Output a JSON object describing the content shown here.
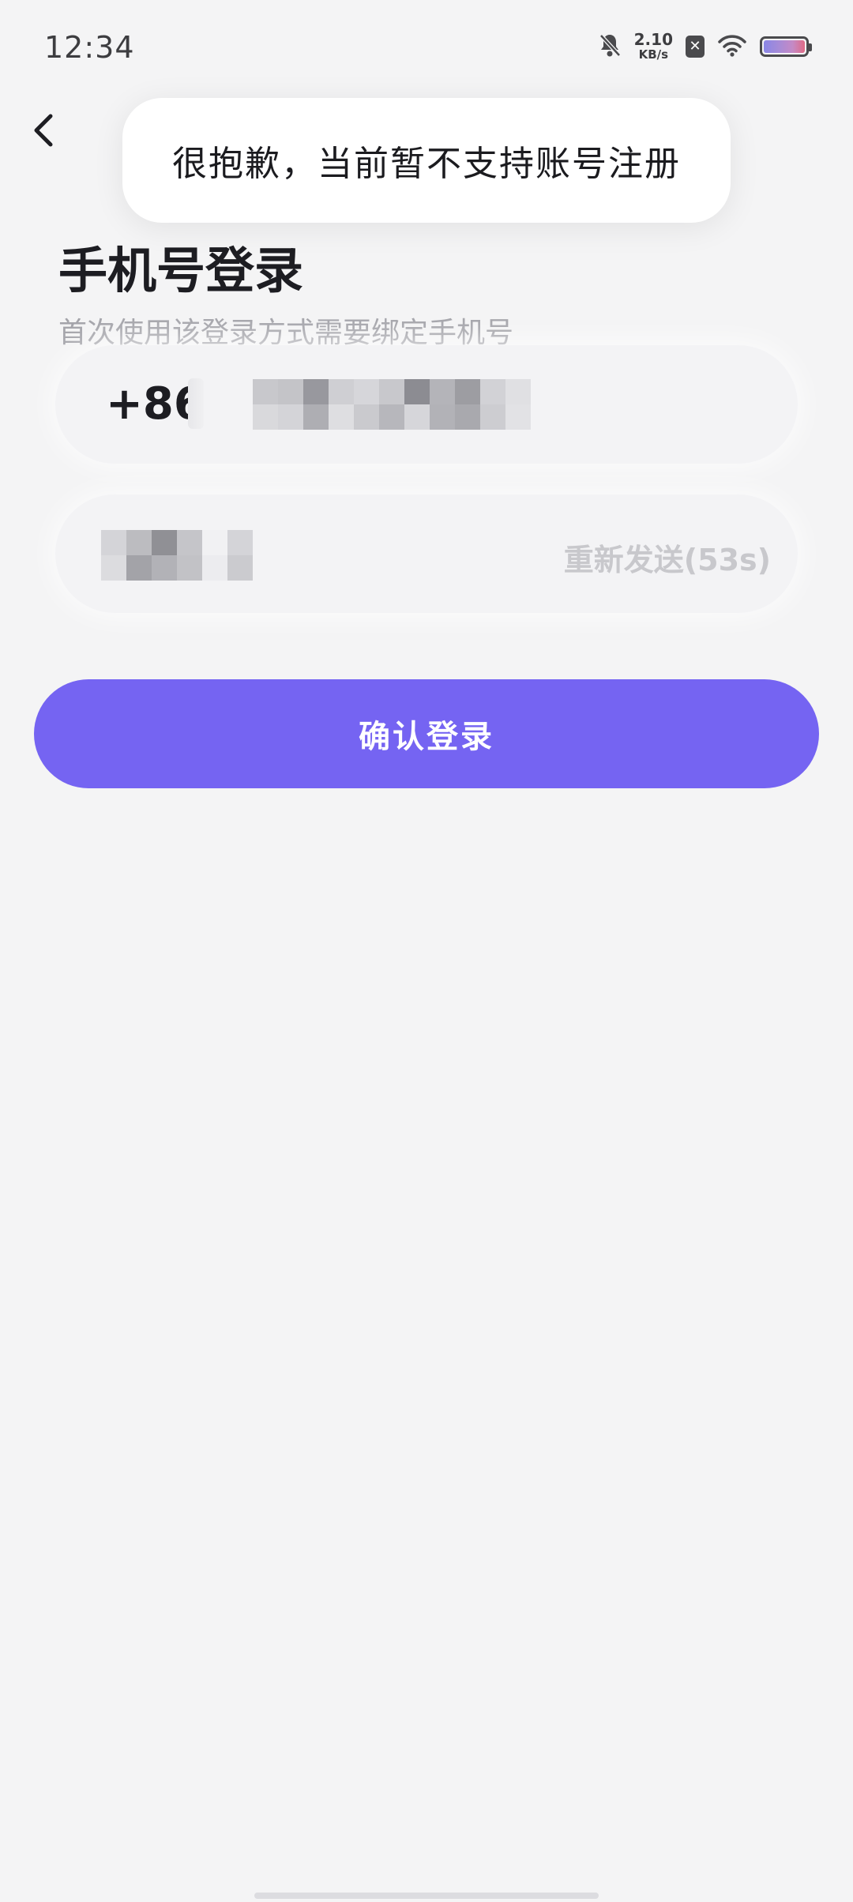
{
  "status_bar": {
    "time": "12:34",
    "net_speed_value": "2.10",
    "net_speed_unit": "KB/s",
    "icons": [
      "mute-bell-icon",
      "no-sim-icon",
      "wifi-icon",
      "battery-icon"
    ]
  },
  "back": {
    "icon": "chevron-left-icon"
  },
  "toast": {
    "message": "很抱歉，当前暂不支持账号注册"
  },
  "login": {
    "title": "手机号登录",
    "subtitle": "首次使用该登录方式需要绑定手机号",
    "phone": {
      "country_code": "+86",
      "value_masked": true
    },
    "code": {
      "value_masked": true,
      "resend_label": "重新发送(53s)"
    },
    "confirm_label": "确认登录"
  },
  "colors": {
    "primary": "#7564f2",
    "background": "#f4f4f5",
    "text_primary": "#1d1d22",
    "text_secondary": "#a4a4aa",
    "disabled_text": "#c8c8cc"
  }
}
